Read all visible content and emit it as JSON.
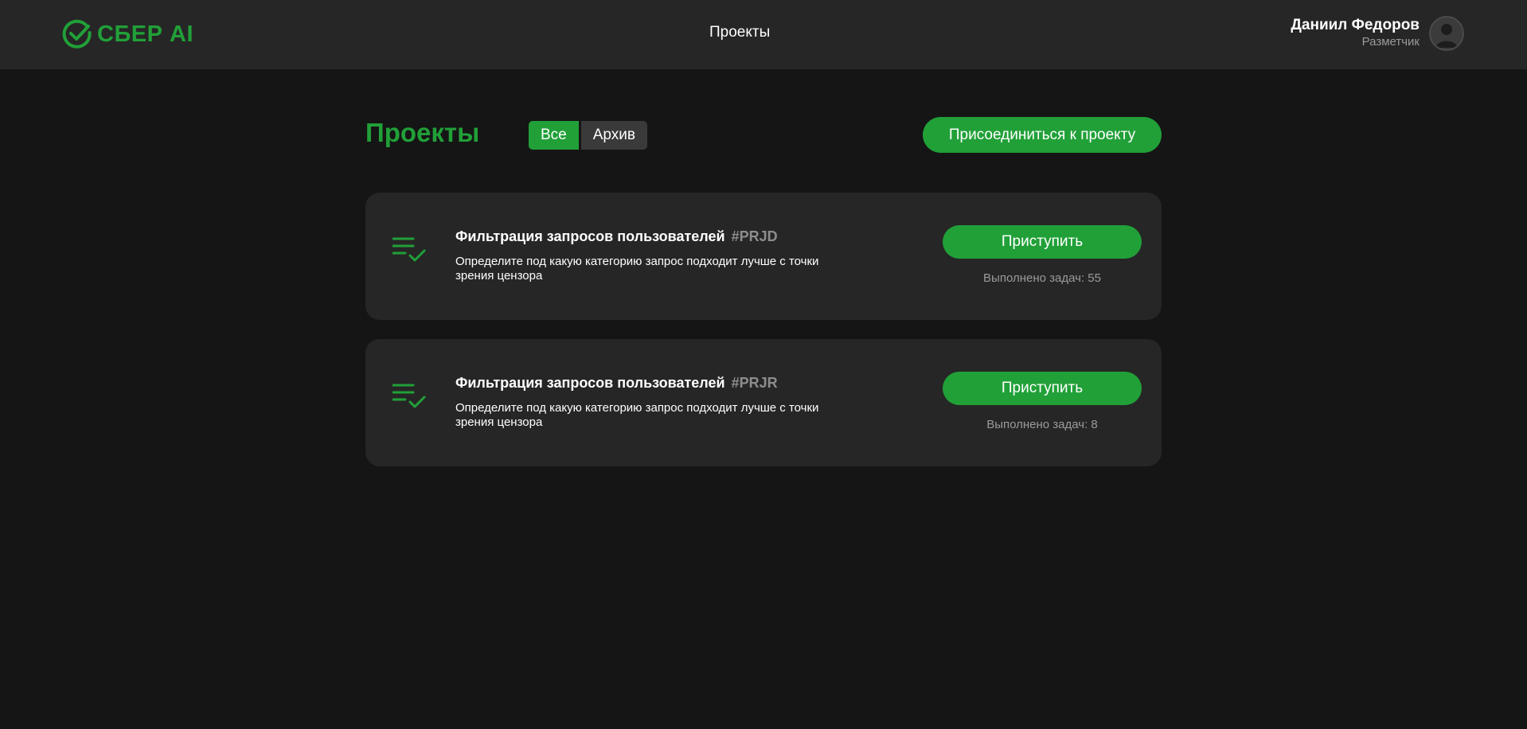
{
  "header": {
    "logo_text": "СБЕР AI",
    "nav_projects": "Проекты",
    "user_name": "Даниил Федоров",
    "user_role": "Разметчик"
  },
  "main": {
    "title": "Проекты",
    "filters": {
      "all": "Все",
      "archive": "Архив",
      "selected": "Все"
    },
    "join_button": "Присоединиться к проекту"
  },
  "projects": [
    {
      "title": "Фильтрация запросов пользователей",
      "code": "#PRJD",
      "description": "Определите под какую категорию запрос подходит лучше с точки зрения цензора",
      "start_label": "Приступить",
      "done_label": "Выполнено задач: 55"
    },
    {
      "title": "Фильтрация запросов пользователей",
      "code": "#PRJR",
      "description": "Определите под какую категорию запрос подходит лучше с точки зрения цензора",
      "start_label": "Приступить",
      "done_label": "Выполнено задач: 8"
    }
  ],
  "colors": {
    "accent": "#21a038",
    "background": "#151515",
    "card": "#262626",
    "muted_text": "#9a9a9a"
  },
  "icons": {
    "logo": "sber-check-icon",
    "avatar": "user-avatar-icon",
    "project": "checklist-icon"
  }
}
